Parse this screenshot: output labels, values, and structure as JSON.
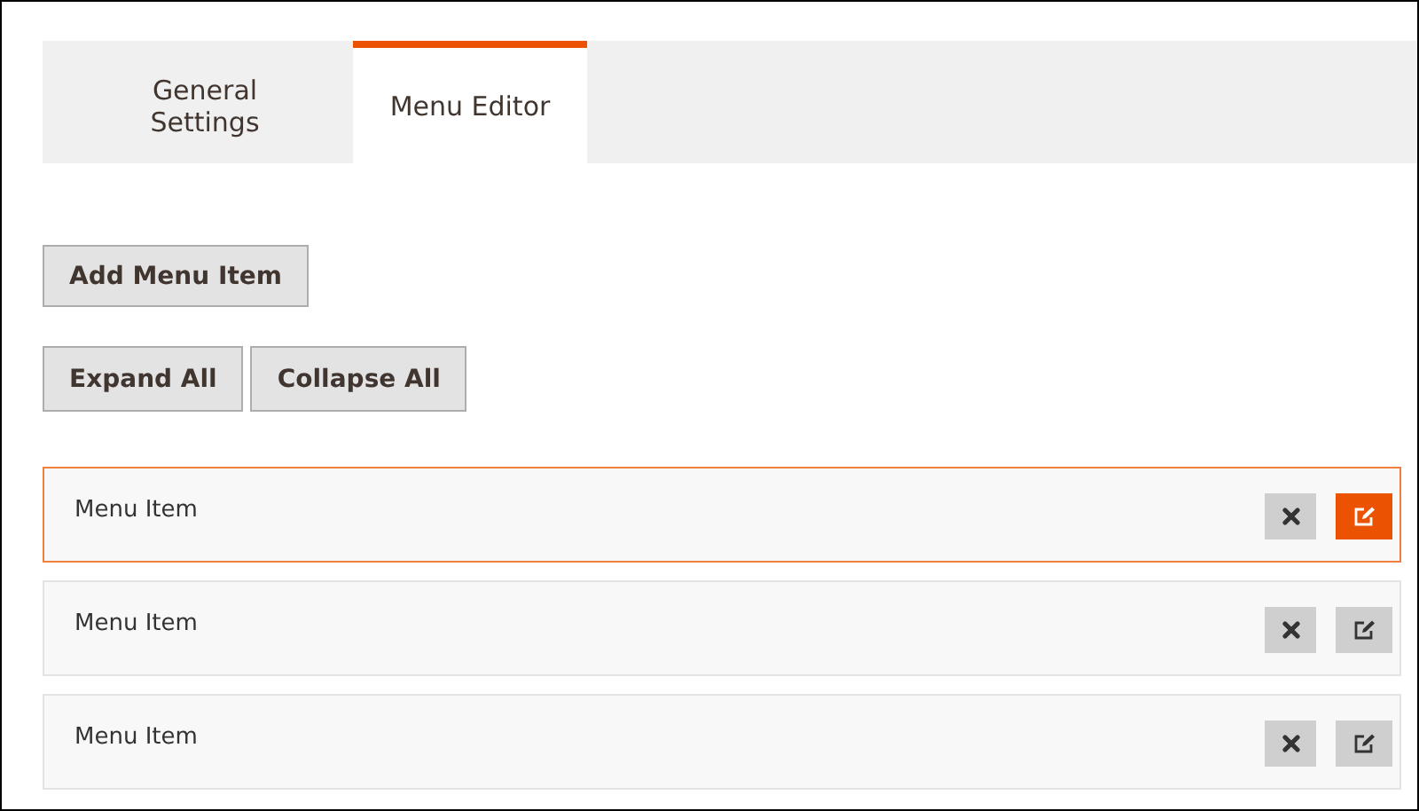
{
  "tabs": [
    {
      "label": "General Settings",
      "selected": false
    },
    {
      "label": "Menu Editor",
      "selected": true
    }
  ],
  "toolbar": {
    "add_button": "Add Menu Item",
    "expand_button": "Expand All",
    "collapse_button": "Collapse All"
  },
  "menu_items": [
    {
      "label": "Menu Item",
      "selected": true
    },
    {
      "label": "Menu Item",
      "selected": false
    },
    {
      "label": "Menu Item",
      "selected": false
    }
  ]
}
